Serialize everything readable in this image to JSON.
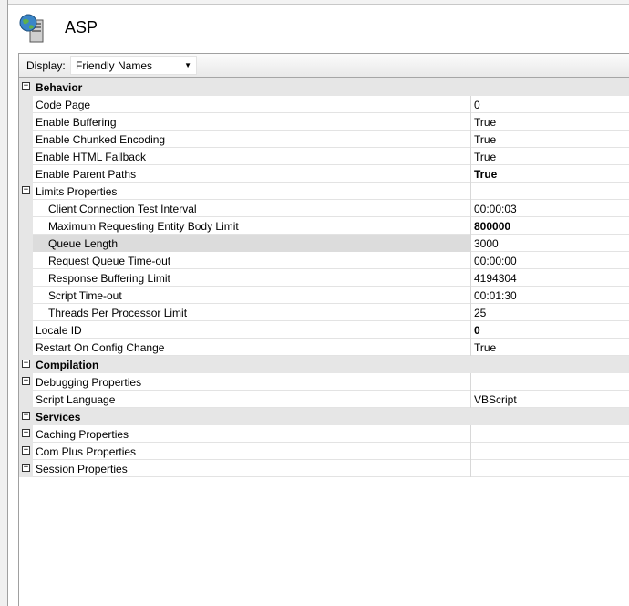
{
  "header": {
    "title": "ASP",
    "icon": "globe-server-icon"
  },
  "toolbar": {
    "display_label": "Display:",
    "display_value": "Friendly Names"
  },
  "rows": [
    {
      "type": "category",
      "label": "Behavior",
      "toggle": "⊟"
    },
    {
      "type": "prop",
      "level": 1,
      "label": "Code Page",
      "value": "0"
    },
    {
      "type": "prop",
      "level": 1,
      "label": "Enable Buffering",
      "value": "True"
    },
    {
      "type": "prop",
      "level": 1,
      "label": "Enable Chunked Encoding",
      "value": "True"
    },
    {
      "type": "prop",
      "level": 1,
      "label": "Enable HTML Fallback",
      "value": "True"
    },
    {
      "type": "prop",
      "level": 1,
      "label": "Enable Parent Paths",
      "value": "True",
      "bold": true
    },
    {
      "type": "group",
      "level": 1,
      "label": "Limits Properties",
      "toggle": "−",
      "value": ""
    },
    {
      "type": "prop",
      "level": 2,
      "label": "Client Connection Test Interval",
      "value": "00:00:03"
    },
    {
      "type": "prop",
      "level": 2,
      "label": "Maximum Requesting Entity Body Limit",
      "value": "800000",
      "bold": true
    },
    {
      "type": "prop",
      "level": 2,
      "label": "Queue Length",
      "value": "3000",
      "selected": true
    },
    {
      "type": "prop",
      "level": 2,
      "label": "Request Queue Time-out",
      "value": "00:00:00"
    },
    {
      "type": "prop",
      "level": 2,
      "label": "Response Buffering Limit",
      "value": "4194304"
    },
    {
      "type": "prop",
      "level": 2,
      "label": "Script Time-out",
      "value": "00:01:30"
    },
    {
      "type": "prop",
      "level": 2,
      "label": "Threads Per Processor Limit",
      "value": "25"
    },
    {
      "type": "prop",
      "level": 1,
      "label": "Locale ID",
      "value": "0",
      "bold": true
    },
    {
      "type": "prop",
      "level": 1,
      "label": "Restart On Config Change",
      "value": "True"
    },
    {
      "type": "category",
      "label": "Compilation",
      "toggle": "⊟"
    },
    {
      "type": "group",
      "level": 1,
      "label": "Debugging Properties",
      "toggle": "+",
      "value": ""
    },
    {
      "type": "prop",
      "level": 1,
      "label": "Script Language",
      "value": "VBScript"
    },
    {
      "type": "category",
      "label": "Services",
      "toggle": "⊟"
    },
    {
      "type": "group",
      "level": 1,
      "label": "Caching Properties",
      "toggle": "+",
      "value": ""
    },
    {
      "type": "group",
      "level": 1,
      "label": "Com Plus Properties",
      "toggle": "+",
      "value": ""
    },
    {
      "type": "group",
      "level": 1,
      "label": "Session Properties",
      "toggle": "+",
      "value": ""
    }
  ]
}
